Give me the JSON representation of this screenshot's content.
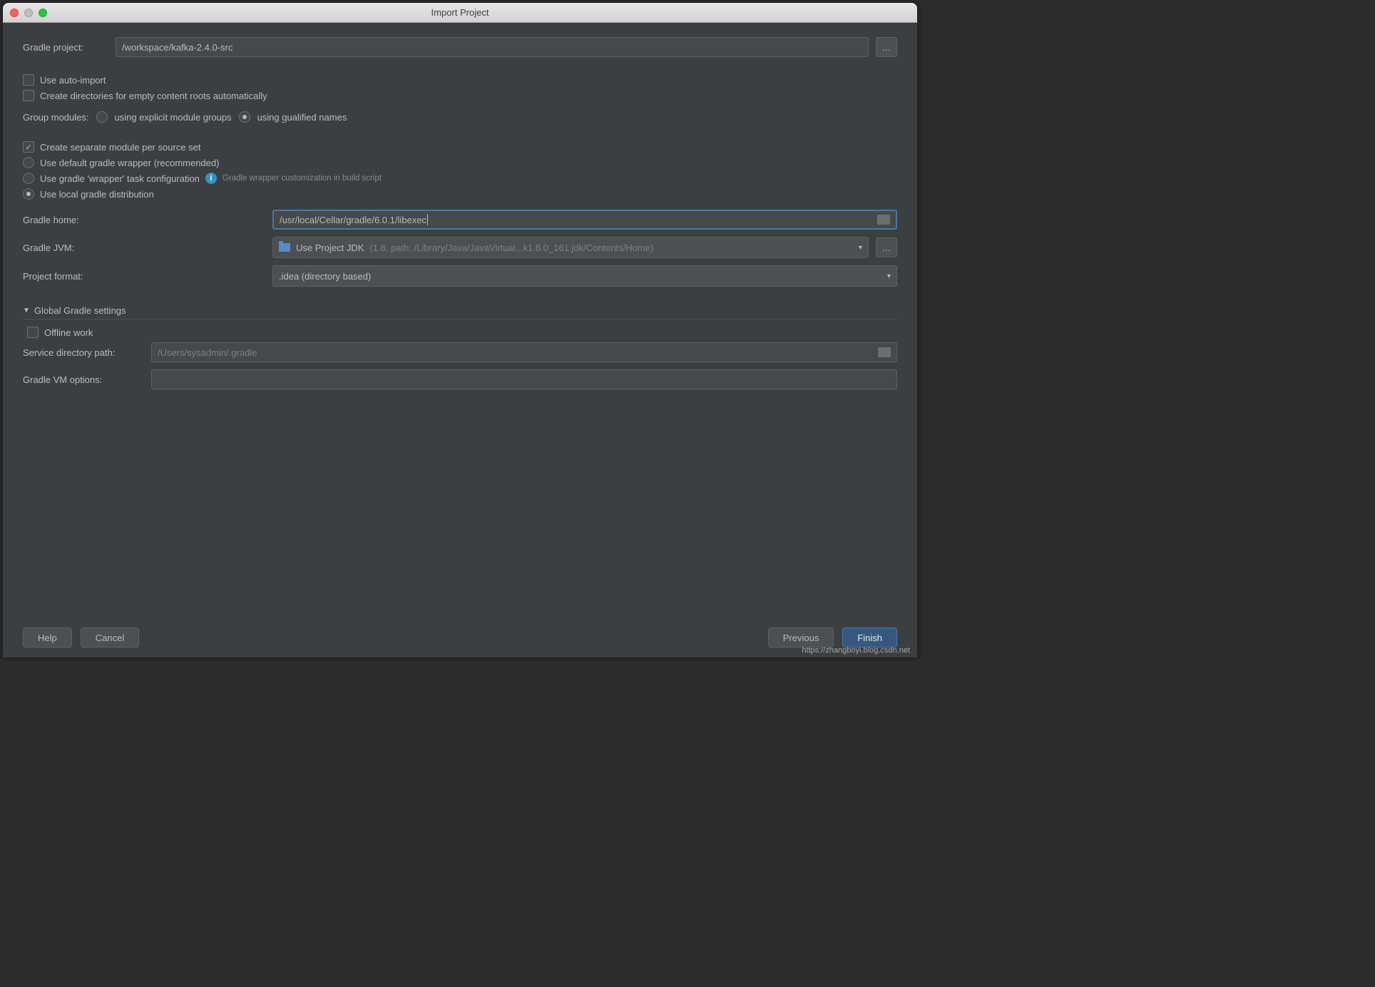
{
  "window": {
    "title": "Import Project"
  },
  "gradleProject": {
    "label": "Gradle project:",
    "value": "/workspace/kafka-2.4.0-src"
  },
  "checkboxes": {
    "autoImport": "Use auto-import",
    "createDirs": "Create directories for empty content roots automatically",
    "separateModule": "Create separate module per source set",
    "offlineWork": "Offline work"
  },
  "groupModules": {
    "label": "Group modules:",
    "opt1_pre": "using explicit module ",
    "opt1_u": "g",
    "opt1_post": "roups",
    "opt2_pre": "using ",
    "opt2_u": "q",
    "opt2_post": "ualified names"
  },
  "gradleSource": {
    "defaultWrapper": "Use default gradle wrapper (recommended)",
    "wrapperTask": "Use gradle 'wrapper' task configuration",
    "wrapperHint": "Gradle wrapper customization in build script",
    "localDist": "Use local gradle distribution"
  },
  "gradleHome": {
    "label": "Gradle home:",
    "value": "/usr/local/Cellar/gradle/6.0.1/libexec"
  },
  "gradleJvm": {
    "label": "Gradle JVM:",
    "main": "Use Project JDK",
    "detail": "(1.8, path: /Library/Java/JavaVirtual...k1.8.0_161.jdk/Contents/Home)"
  },
  "projectFormat": {
    "label": "Project format:",
    "value": ".idea (directory based)"
  },
  "globalSettings": {
    "title": "Global Gradle settings",
    "serviceDirLabel": "Service directory path:",
    "serviceDirValue": "/Users/sysadmin/.gradle",
    "vmOptionsLabel": "Gradle VM options:",
    "vmOptionsValue": ""
  },
  "buttons": {
    "help": "Help",
    "cancel": "Cancel",
    "previous": "Previous",
    "finish": "Finish"
  },
  "watermark": "https://zhangboyi.blog.csdn.net"
}
